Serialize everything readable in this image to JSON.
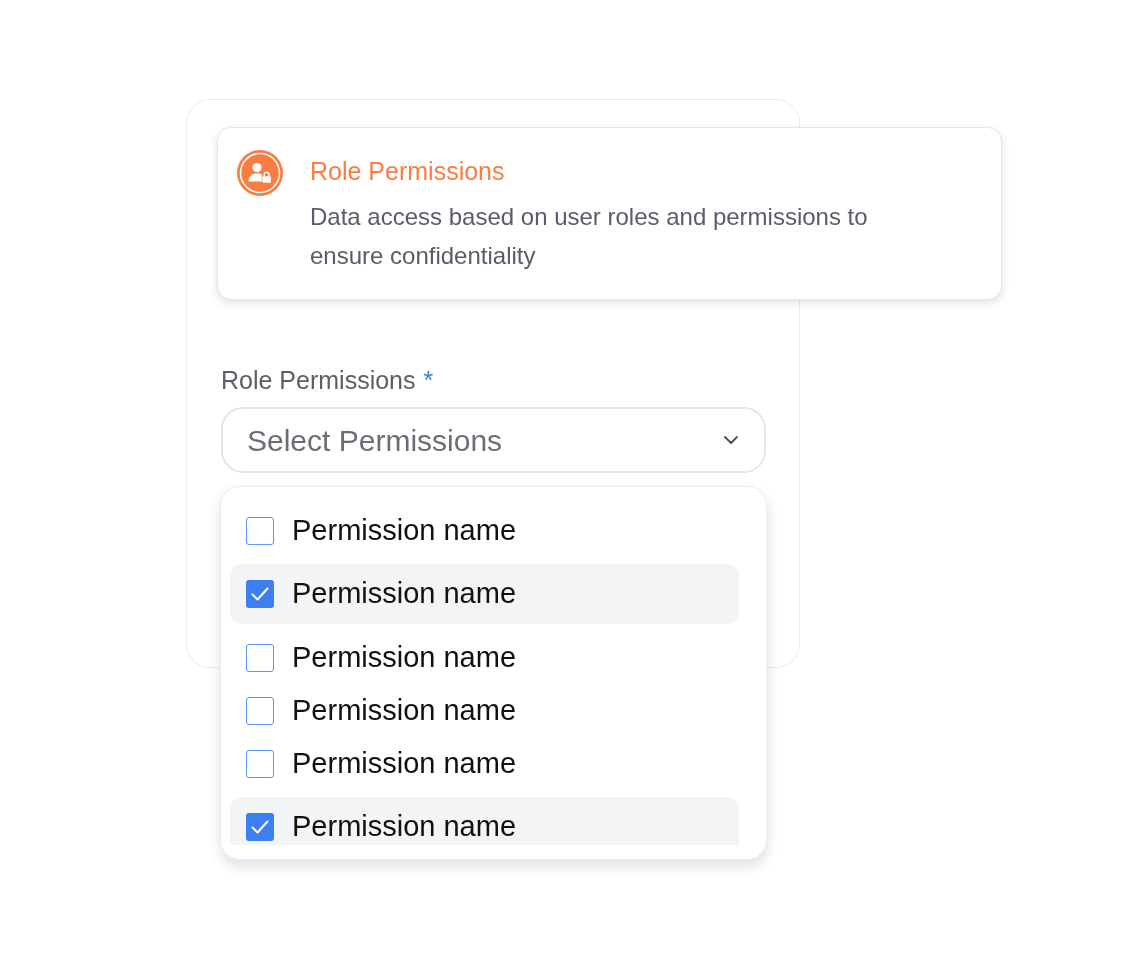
{
  "info_card": {
    "title": "Role Permissions",
    "description": "Data access based on user roles and permissions to ensure confidentiality"
  },
  "field": {
    "label": "Role Permissions",
    "required_mark": "*",
    "placeholder": "Select Permissions"
  },
  "dropdown": {
    "options": [
      {
        "label": "Permission name",
        "checked": false
      },
      {
        "label": "Permission name",
        "checked": true
      },
      {
        "label": "Permission name",
        "checked": false
      },
      {
        "label": "Permission name",
        "checked": false
      },
      {
        "label": "Permission name",
        "checked": false
      },
      {
        "label": "Permission name",
        "checked": true
      }
    ]
  }
}
